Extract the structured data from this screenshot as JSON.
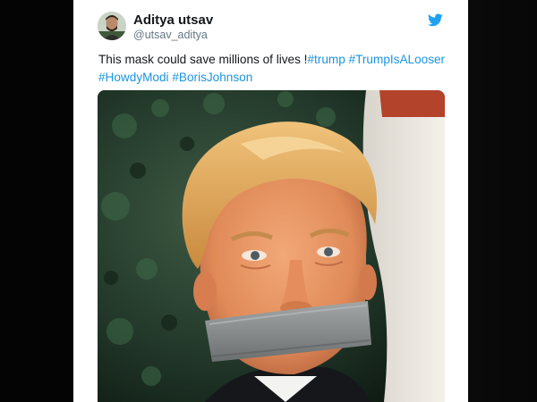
{
  "tweet": {
    "author": {
      "display_name": "Aditya utsav",
      "handle": "@utsav_aditya",
      "avatar_icon": "user-avatar"
    },
    "text_prefix": "This mask could save millions of lives ",
    "text_bang": "!",
    "hashtags": [
      "#trump",
      "#TrumpIsALooser",
      "#HowdyModi",
      "#BorisJohnson"
    ],
    "platform_icon": "twitter-bird-icon",
    "media": {
      "type": "photo"
    }
  },
  "colors": {
    "hashtag": "#1b95e0",
    "name": "#14171a",
    "handle": "#657786",
    "twitter_brand": "#1da1f2",
    "background": "#050505"
  }
}
